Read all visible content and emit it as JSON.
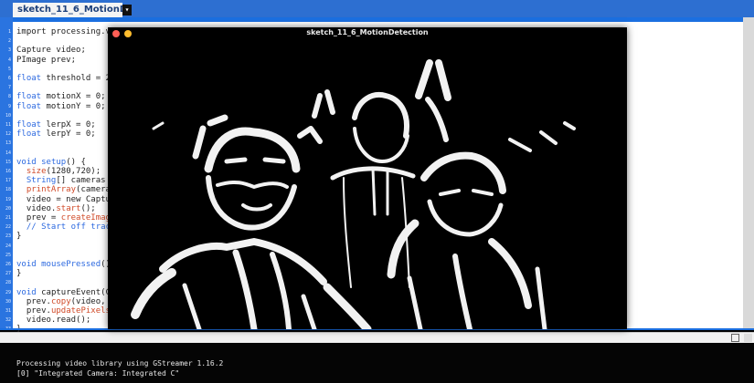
{
  "editor": {
    "tab_label": "sketch_11_6_MotionDetection",
    "tab_menu_glyph": "▾",
    "lines": [
      {
        "n": "1",
        "segments": [
          {
            "t": "import processing.vid",
            "c": "plain"
          }
        ]
      },
      {
        "n": "2",
        "segments": []
      },
      {
        "n": "3",
        "segments": [
          {
            "t": "Capture video;",
            "c": "plain"
          }
        ]
      },
      {
        "n": "4",
        "segments": [
          {
            "t": "PImage prev;",
            "c": "plain"
          }
        ]
      },
      {
        "n": "5",
        "segments": []
      },
      {
        "n": "6",
        "segments": [
          {
            "t": "float",
            "c": "kw"
          },
          {
            "t": " threshold = 25;",
            "c": "plain"
          }
        ]
      },
      {
        "n": "7",
        "segments": []
      },
      {
        "n": "8",
        "segments": [
          {
            "t": "float",
            "c": "kw"
          },
          {
            "t": " motionX = 0;",
            "c": "plain"
          }
        ]
      },
      {
        "n": "9",
        "segments": [
          {
            "t": "float",
            "c": "kw"
          },
          {
            "t": " motionY = 0;",
            "c": "plain"
          }
        ]
      },
      {
        "n": "10",
        "segments": []
      },
      {
        "n": "11",
        "segments": [
          {
            "t": "float",
            "c": "kw"
          },
          {
            "t": " lerpX = 0;",
            "c": "plain"
          }
        ]
      },
      {
        "n": "12",
        "segments": [
          {
            "t": "float",
            "c": "kw"
          },
          {
            "t": " lerpY = 0;",
            "c": "plain"
          }
        ]
      },
      {
        "n": "13",
        "segments": []
      },
      {
        "n": "14",
        "segments": []
      },
      {
        "n": "15",
        "segments": [
          {
            "t": "void",
            "c": "kw"
          },
          {
            "t": " setup",
            "c": "kw"
          },
          {
            "t": "() {",
            "c": "plain"
          }
        ]
      },
      {
        "n": "16",
        "segments": [
          {
            "t": "  size",
            "c": "fn"
          },
          {
            "t": "(1280,720);",
            "c": "plain"
          }
        ]
      },
      {
        "n": "17",
        "segments": [
          {
            "t": "  String",
            "c": "kw"
          },
          {
            "t": "[] cameras = ",
            "c": "plain"
          }
        ]
      },
      {
        "n": "18",
        "segments": [
          {
            "t": "  printArray",
            "c": "fn"
          },
          {
            "t": "(cameras)",
            "c": "plain"
          }
        ]
      },
      {
        "n": "19",
        "segments": [
          {
            "t": "  video = new Capture",
            "c": "plain"
          }
        ]
      },
      {
        "n": "20",
        "segments": [
          {
            "t": "  video.",
            "c": "plain"
          },
          {
            "t": "start",
            "c": "fn"
          },
          {
            "t": "();",
            "c": "plain"
          }
        ]
      },
      {
        "n": "21",
        "segments": [
          {
            "t": "  prev = ",
            "c": "plain"
          },
          {
            "t": "createImage",
            "c": "fn"
          },
          {
            "t": "(",
            "c": "plain"
          }
        ]
      },
      {
        "n": "22",
        "segments": [
          {
            "t": "  // Start off tracki",
            "c": "kw"
          }
        ]
      },
      {
        "n": "23",
        "segments": [
          {
            "t": "}",
            "c": "plain"
          }
        ]
      },
      {
        "n": "24",
        "segments": []
      },
      {
        "n": "25",
        "segments": []
      },
      {
        "n": "26",
        "segments": [
          {
            "t": "void",
            "c": "kw"
          },
          {
            "t": " mousePressed",
            "c": "kw"
          },
          {
            "t": "() {",
            "c": "plain"
          }
        ]
      },
      {
        "n": "27",
        "segments": [
          {
            "t": "}",
            "c": "plain"
          }
        ]
      },
      {
        "n": "28",
        "segments": []
      },
      {
        "n": "29",
        "segments": [
          {
            "t": "void",
            "c": "kw"
          },
          {
            "t": " captureEvent(Capt",
            "c": "plain"
          }
        ]
      },
      {
        "n": "30",
        "segments": [
          {
            "t": "  prev.",
            "c": "plain"
          },
          {
            "t": "copy",
            "c": "fn"
          },
          {
            "t": "(video, 0,",
            "c": "plain"
          }
        ]
      },
      {
        "n": "31",
        "segments": [
          {
            "t": "  prev.",
            "c": "plain"
          },
          {
            "t": "updatePixels",
            "c": "fn"
          },
          {
            "t": "()",
            "c": "plain"
          }
        ]
      },
      {
        "n": "32",
        "segments": [
          {
            "t": "  video.read();",
            "c": "plain"
          }
        ]
      },
      {
        "n": "33",
        "segments": [
          {
            "t": "}",
            "c": "plain"
          }
        ]
      }
    ]
  },
  "console": {
    "lines": [
      "Processing video library using GStreamer 1.16.2",
      "[0] \"Integrated Camera: Integrated C\""
    ]
  },
  "sketch_window": {
    "title": "sketch_11_6_MotionDetection"
  },
  "colors": {
    "accent": "#2d6fd1",
    "keyword": "#2d6ae0",
    "function": "#d04a28"
  }
}
